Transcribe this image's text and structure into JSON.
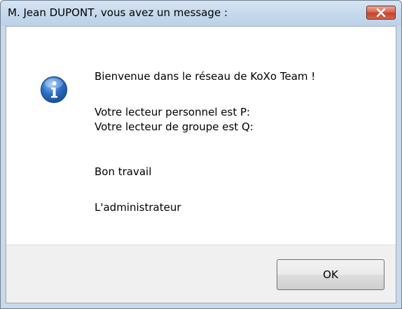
{
  "dialog": {
    "title": "M. Jean DUPONT, vous avez un message :",
    "close_label": "✕",
    "icon": "information-icon",
    "message_lines": [
      "Bienvenue dans le réseau de KoXo Team !",
      "Votre lecteur personnel est P:",
      "Votre lecteur de groupe est Q:",
      "Bon travail",
      "L'administrateur"
    ],
    "ok_label": "OK"
  },
  "colors": {
    "titlebar": "#c5d8ec",
    "close_button": "#c3422b",
    "info_icon": "#2a6fc4",
    "footer": "#f0f0f0"
  }
}
